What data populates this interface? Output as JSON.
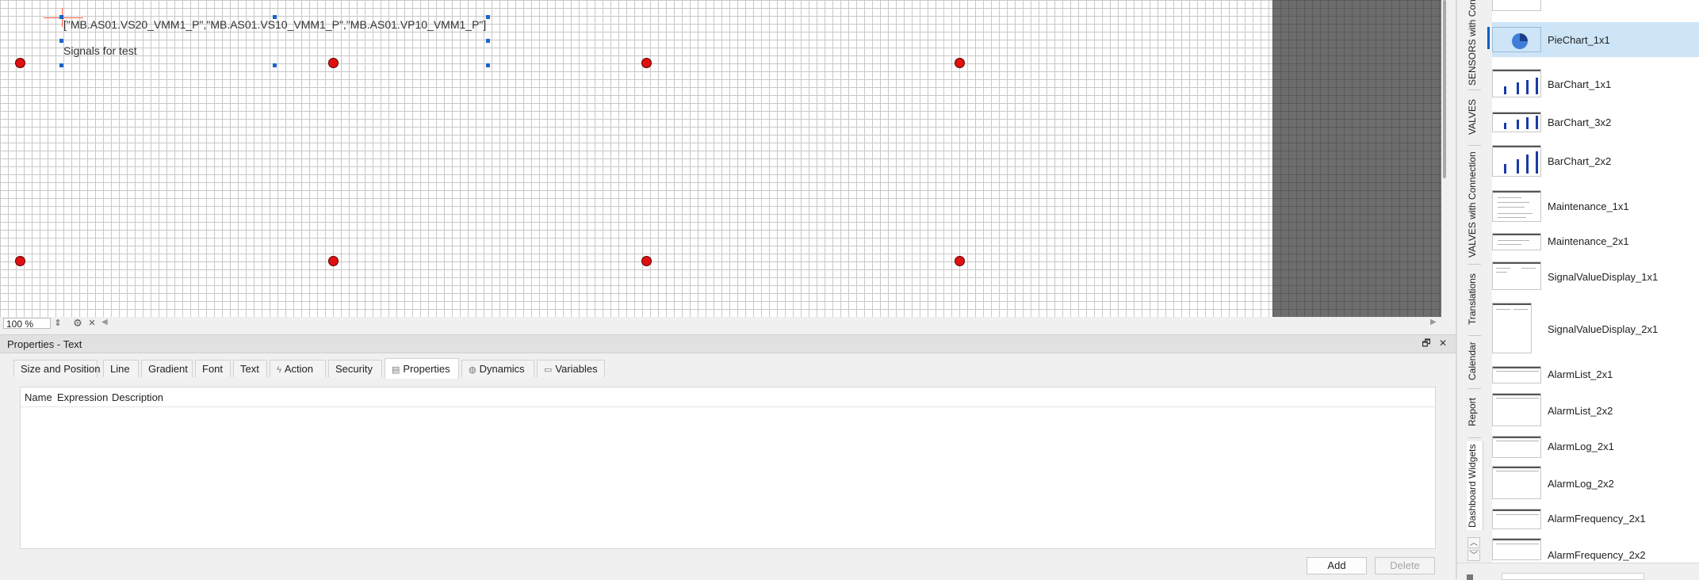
{
  "canvas": {
    "text_line1": "[\"MB.AS01.VS20_VMM1_P\",\"MB.AS01.VS10_VMM1_P\",\"MB.AS01.VP10_VMM1_P\"]",
    "text_line2": "Signals for test",
    "zoom": "100 %"
  },
  "properties": {
    "title": "Properties - Text",
    "tabs": [
      {
        "label": "Size and Position",
        "icon": ""
      },
      {
        "label": "Line",
        "icon": ""
      },
      {
        "label": "Gradient",
        "icon": ""
      },
      {
        "label": "Font",
        "icon": ""
      },
      {
        "label": "Text",
        "icon": ""
      },
      {
        "label": "Action",
        "icon": "action-icon"
      },
      {
        "label": "Security",
        "icon": ""
      },
      {
        "label": "Properties",
        "icon": "document-icon"
      },
      {
        "label": "Dynamics",
        "icon": "dynamics-icon"
      },
      {
        "label": "Variables",
        "icon": "variables-icon"
      }
    ],
    "active_tab": "Properties",
    "columns": [
      "Name",
      "Expression",
      "Description"
    ],
    "add_button": "Add",
    "delete_button": "Delete"
  },
  "side_tabs": [
    "SENSORS with Con",
    "VALVES",
    "VALVES with Connection",
    "Translations",
    "Calendar",
    "Report",
    "Dashboard Widgets"
  ],
  "active_side_tab": "Dashboard Widgets",
  "widgets": [
    "PieChart_1x1",
    "BarChart_1x1",
    "BarChart_3x2",
    "BarChart_2x2",
    "Maintenance_1x1",
    "Maintenance_2x1",
    "SignalValueDisplay_1x1",
    "SignalValueDisplay_2x1",
    "AlarmList_2x1",
    "AlarmList_2x2",
    "AlarmLog_2x1",
    "AlarmLog_2x2",
    "AlarmFrequency_2x1",
    "AlarmFrequency_2x2"
  ],
  "selected_widget": "PieChart_1x1",
  "colors": {
    "accent": "#0060c0",
    "selection": "#cde5f7",
    "anchor_dot": "#e01010",
    "handle": "#1c64c8"
  }
}
